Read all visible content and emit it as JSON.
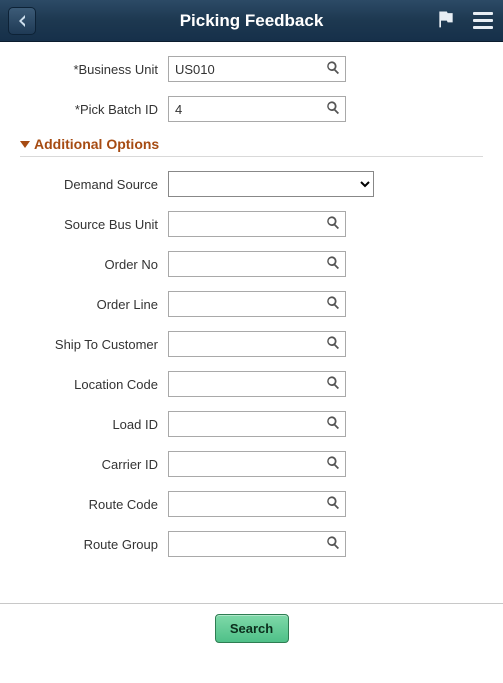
{
  "header": {
    "title": "Picking Feedback"
  },
  "primary": {
    "business_unit": {
      "label": "*Business Unit",
      "value": "US010"
    },
    "pick_batch_id": {
      "label": "*Pick Batch ID",
      "value": "4"
    }
  },
  "section": {
    "title": "Additional Options"
  },
  "options": {
    "demand_source": {
      "label": "Demand Source",
      "value": ""
    },
    "source_bus_unit": {
      "label": "Source Bus Unit",
      "value": ""
    },
    "order_no": {
      "label": "Order No",
      "value": ""
    },
    "order_line": {
      "label": "Order Line",
      "value": ""
    },
    "ship_to_customer": {
      "label": "Ship To Customer",
      "value": ""
    },
    "location_code": {
      "label": "Location Code",
      "value": ""
    },
    "load_id": {
      "label": "Load ID",
      "value": ""
    },
    "carrier_id": {
      "label": "Carrier ID",
      "value": ""
    },
    "route_code": {
      "label": "Route Code",
      "value": ""
    },
    "route_group": {
      "label": "Route Group",
      "value": ""
    }
  },
  "footer": {
    "search_label": "Search"
  }
}
